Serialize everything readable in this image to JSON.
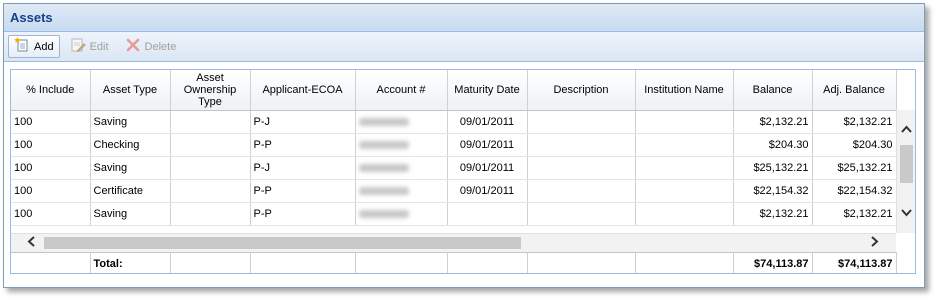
{
  "panel": {
    "title": "Assets"
  },
  "toolbar": {
    "add_label": "Add",
    "edit_label": "Edit",
    "delete_label": "Delete"
  },
  "grid": {
    "columns": [
      "% Include",
      "Asset Type",
      "Asset Ownership Type",
      "Applicant-ECOA",
      "Account #",
      "Maturity Date",
      "Description",
      "Institution Name",
      "Balance",
      "Adj. Balance"
    ],
    "rows": [
      {
        "include": "100",
        "asset_type": "Saving",
        "ownership": "",
        "ecoa": "P-J",
        "account": "",
        "maturity": "09/01/2011",
        "description": "",
        "institution": "",
        "balance": "$2,132.21",
        "adj_balance": "$2,132.21"
      },
      {
        "include": "100",
        "asset_type": "Checking",
        "ownership": "",
        "ecoa": "P-P",
        "account": "",
        "maturity": "09/01/2011",
        "description": "",
        "institution": "",
        "balance": "$204.30",
        "adj_balance": "$204.30"
      },
      {
        "include": "100",
        "asset_type": "Saving",
        "ownership": "",
        "ecoa": "P-J",
        "account": "",
        "maturity": "09/01/2011",
        "description": "",
        "institution": "",
        "balance": "$25,132.21",
        "adj_balance": "$25,132.21"
      },
      {
        "include": "100",
        "asset_type": "Certificate",
        "ownership": "",
        "ecoa": "P-P",
        "account": "",
        "maturity": "09/01/2011",
        "description": "",
        "institution": "",
        "balance": "$22,154.32",
        "adj_balance": "$22,154.32"
      },
      {
        "include": "100",
        "asset_type": "Saving",
        "ownership": "",
        "ecoa": "P-P",
        "account": "",
        "maturity": "",
        "description": "",
        "institution": "",
        "balance": "$2,132.21",
        "adj_balance": "$2,132.21"
      }
    ],
    "footer": {
      "label": "Total:",
      "balance_total": "$74,113.87",
      "adj_balance_total": "$74,113.87"
    }
  },
  "icons": {
    "add": "add-document-icon",
    "edit": "edit-document-icon",
    "delete": "delete-x-icon",
    "scroll_up": "chevron-up-icon",
    "scroll_down": "chevron-down-icon",
    "scroll_left": "chevron-left-icon",
    "scroll_right": "chevron-right-icon"
  },
  "colors": {
    "title_text": "#15428b",
    "header_border": "#99bbe8",
    "delete_icon": "#e05555"
  }
}
